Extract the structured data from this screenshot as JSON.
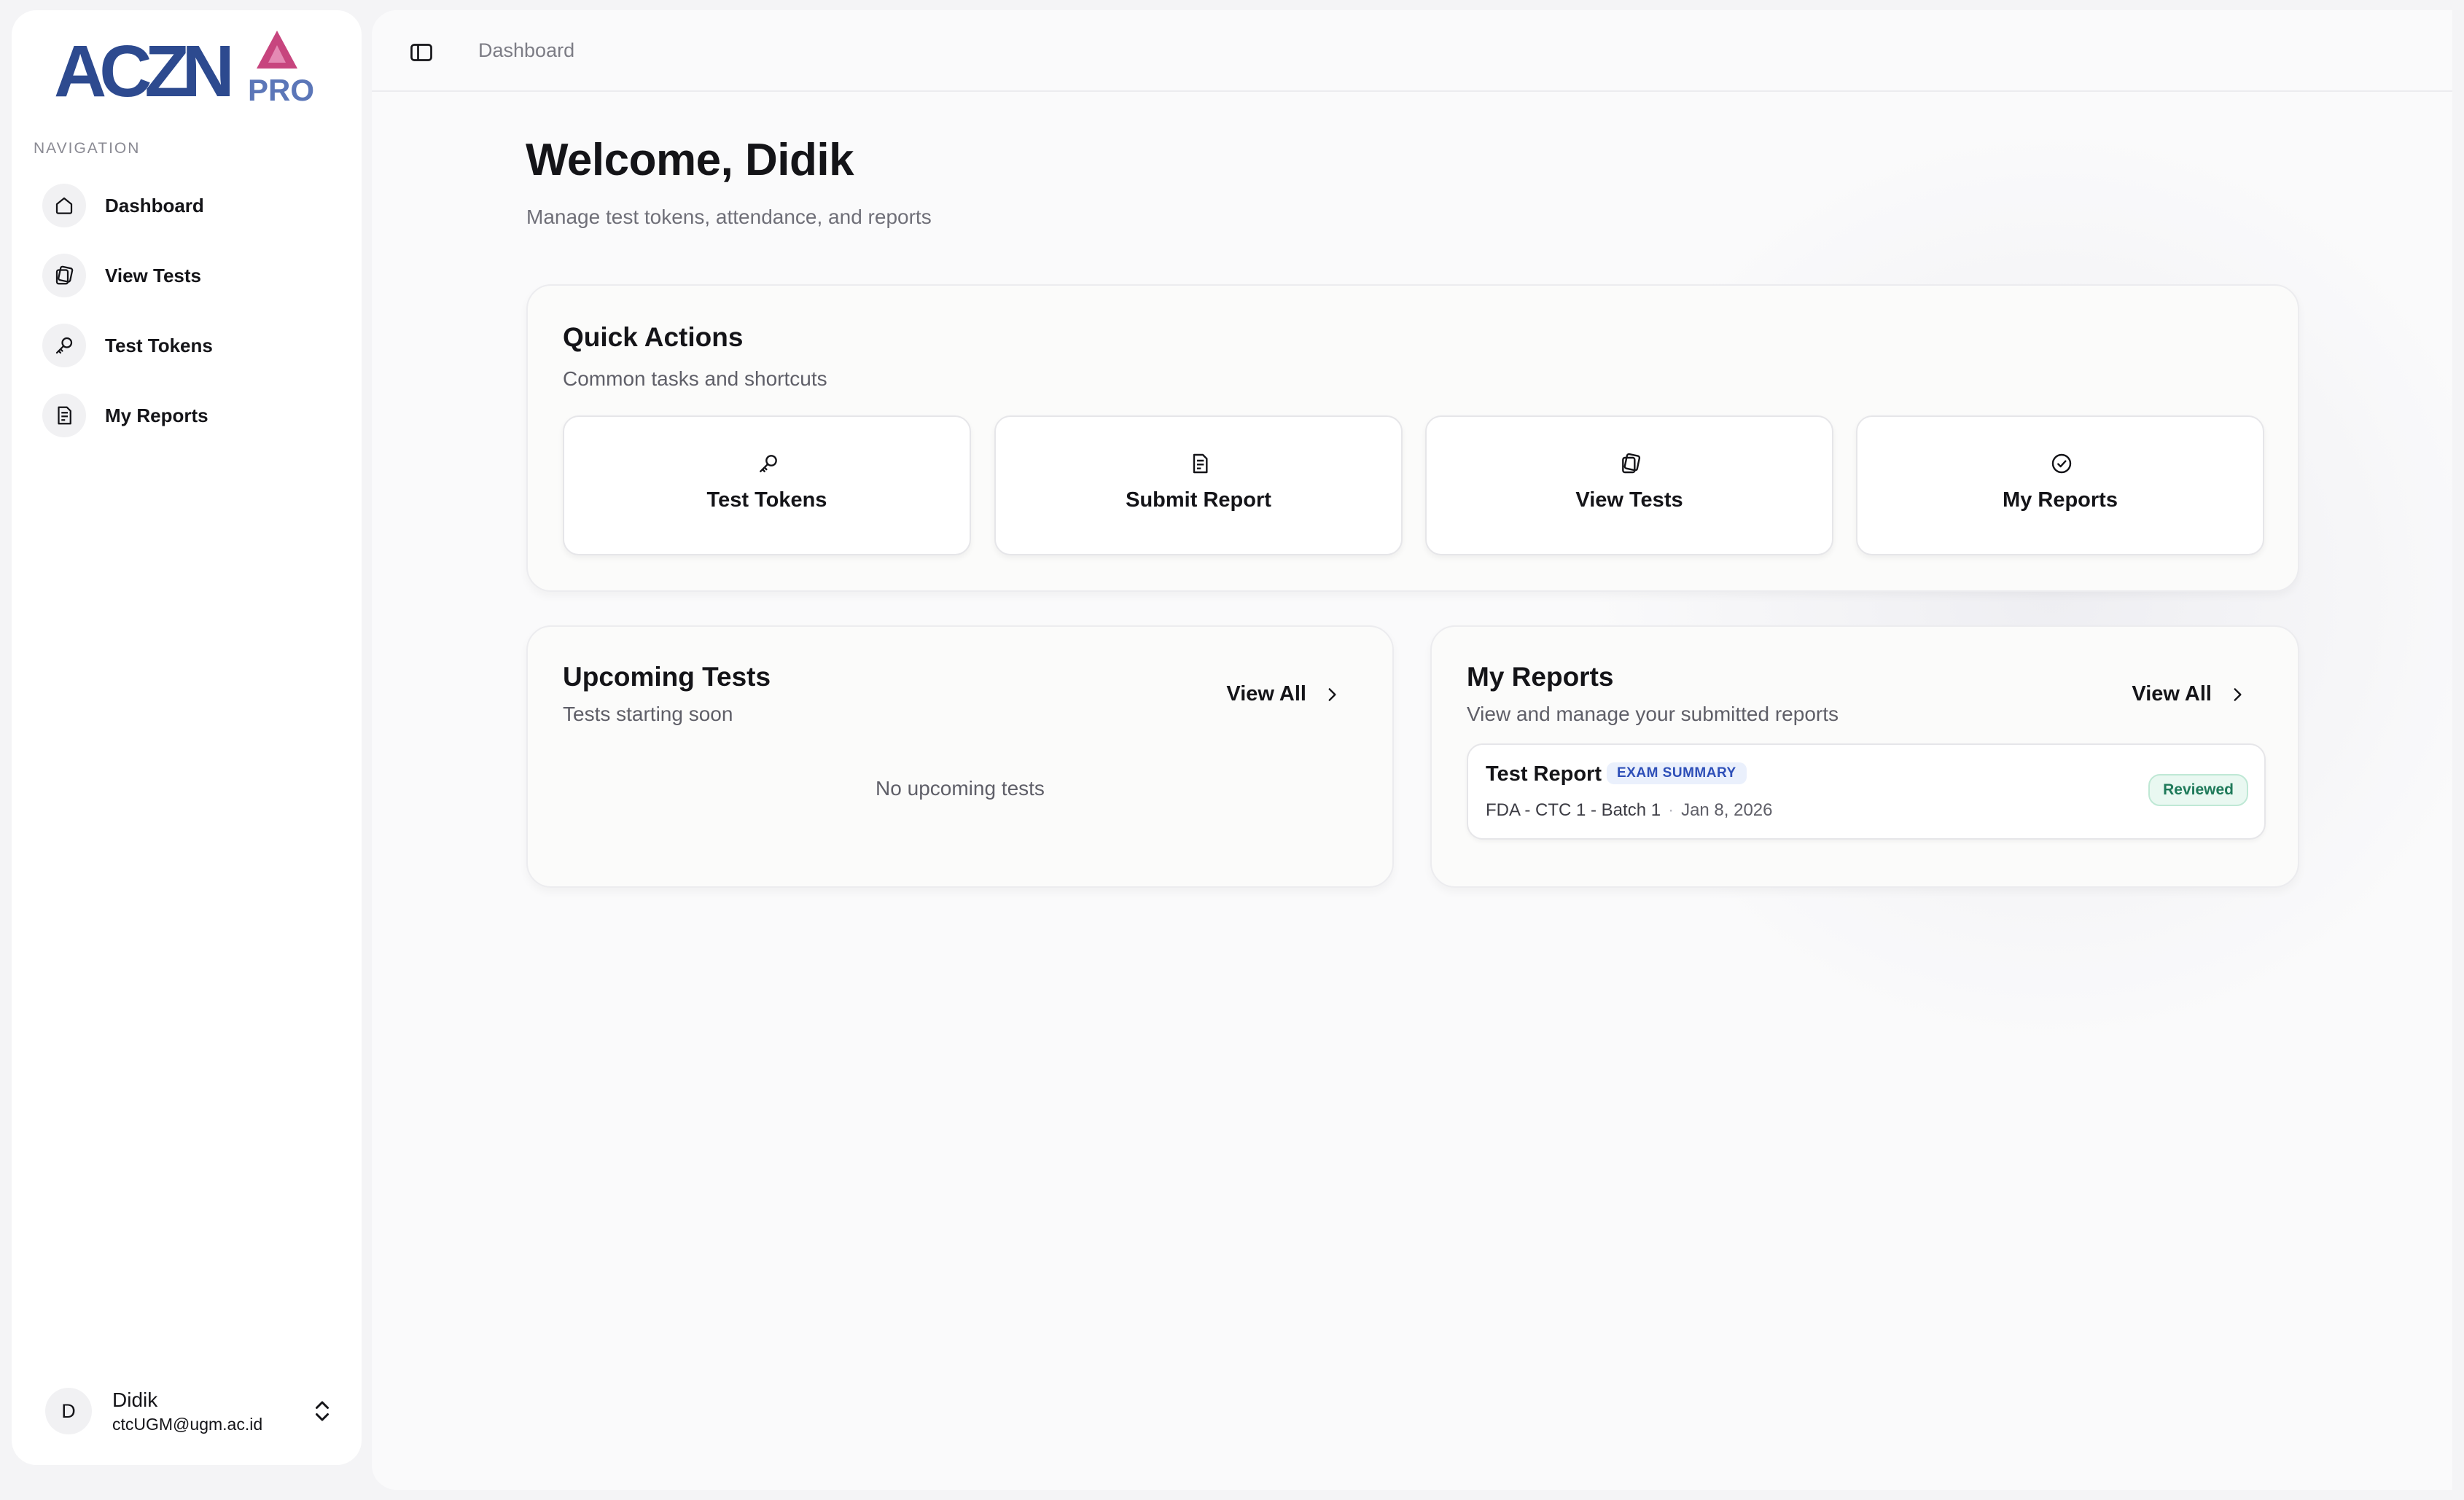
{
  "logo": {
    "text": "ACZN",
    "badge": "PRO",
    "brand_color": "#2d4a8f",
    "accent_color": "#c7457e"
  },
  "sidebar": {
    "heading": "NAVIGATION",
    "items": [
      {
        "label": "Dashboard",
        "icon": "home-icon"
      },
      {
        "label": "View Tests",
        "icon": "tests-icon"
      },
      {
        "label": "Test Tokens",
        "icon": "key-icon"
      },
      {
        "label": "My Reports",
        "icon": "report-icon"
      }
    ]
  },
  "user": {
    "initial": "D",
    "name": "Didik",
    "email": "ctcUGM@ugm.ac.id"
  },
  "header": {
    "breadcrumb": "Dashboard"
  },
  "main": {
    "welcome": "Welcome, Didik",
    "subtitle": "Manage test tokens, attendance, and reports"
  },
  "quick_actions": {
    "title": "Quick Actions",
    "subtitle": "Common tasks and shortcuts",
    "buttons": [
      {
        "label": "Test Tokens",
        "icon": "key-icon"
      },
      {
        "label": "Submit Report",
        "icon": "report-icon"
      },
      {
        "label": "View Tests",
        "icon": "tests-icon"
      },
      {
        "label": "My Reports",
        "icon": "check-circle-icon"
      }
    ]
  },
  "upcoming_tests": {
    "title": "Upcoming Tests",
    "subtitle": "Tests starting soon",
    "view_all": "View All",
    "empty_text": "No upcoming tests"
  },
  "my_reports": {
    "title": "My Reports",
    "subtitle": "View and manage your submitted reports",
    "view_all": "View All",
    "items": [
      {
        "title": "Test Report",
        "type": "EXAM SUMMARY",
        "test": "FDA - CTC 1 - Batch 1",
        "date": "Jan 8, 2026",
        "status": "Reviewed"
      }
    ]
  }
}
